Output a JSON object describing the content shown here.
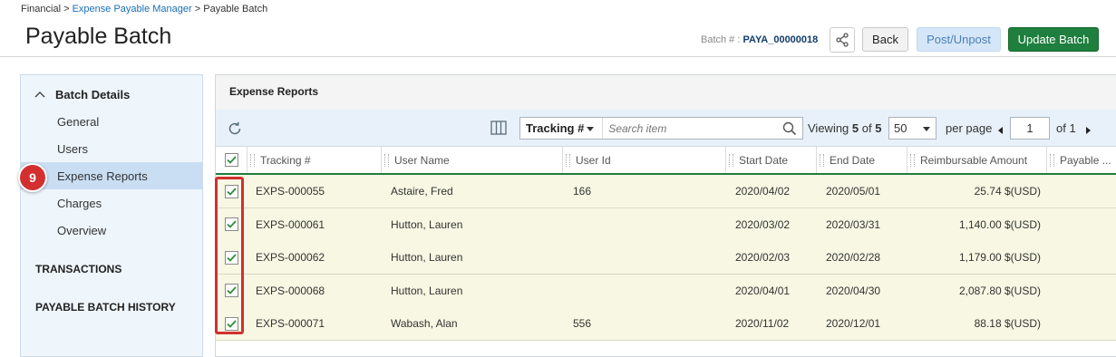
{
  "breadcrumb": {
    "root": "Financial",
    "sep": ">",
    "link": "Expense Payable Manager",
    "current": "Payable Batch"
  },
  "page_title": "Payable Batch",
  "batch": {
    "label": "Batch # :",
    "value": "PAYA_00000018"
  },
  "actions": {
    "back": "Back",
    "post": "Post/Unpost",
    "update": "Update Batch"
  },
  "sidebar": {
    "section_title": "Batch Details",
    "items": [
      {
        "label": "General"
      },
      {
        "label": "Users"
      },
      {
        "label": "Expense Reports"
      },
      {
        "label": "Charges"
      },
      {
        "label": "Overview"
      }
    ],
    "sections": [
      "TRANSACTIONS",
      "PAYABLE BATCH HISTORY"
    ],
    "step_badge": "9"
  },
  "panel": {
    "title": "Expense Reports",
    "search": {
      "field": "Tracking #",
      "placeholder": "Search item"
    },
    "viewing": {
      "prefix": "Viewing",
      "shown": "5",
      "of": "of",
      "total": "5"
    },
    "per_page": {
      "value": "50",
      "label": "per page"
    },
    "pager": {
      "page": "1",
      "of_label": "of 1"
    }
  },
  "columns": [
    "Tracking #",
    "User Name",
    "User Id",
    "Start Date",
    "End Date",
    "Reimbursable Amount",
    "Payable ..."
  ],
  "rows": [
    {
      "tracking": "EXPS-000055",
      "user": "Astaire, Fred",
      "user_id": "166",
      "start": "2020/04/02",
      "end": "2020/05/01",
      "amount": "25.74 $(USD)"
    },
    {
      "tracking": "EXPS-000061",
      "user": "Hutton, Lauren",
      "user_id": "",
      "start": "2020/03/02",
      "end": "2020/03/31",
      "amount": "1,140.00 $(USD)"
    },
    {
      "tracking": "EXPS-000062",
      "user": "Hutton, Lauren",
      "user_id": "",
      "start": "2020/02/03",
      "end": "2020/02/28",
      "amount": "1,179.00 $(USD)"
    },
    {
      "tracking": "EXPS-000068",
      "user": "Hutton, Lauren",
      "user_id": "",
      "start": "2020/04/01",
      "end": "2020/04/30",
      "amount": "2,087.80 $(USD)"
    },
    {
      "tracking": "EXPS-000071",
      "user": "Wabash, Alan",
      "user_id": "556",
      "start": "2020/11/02",
      "end": "2020/12/01",
      "amount": "88.18 $(USD)"
    }
  ],
  "colors": {
    "accent_green": "#1e7f3e",
    "post_blue": "#d5e6f8",
    "row_bg": "#f7f7e3",
    "highlight_red": "#d32f2f"
  }
}
